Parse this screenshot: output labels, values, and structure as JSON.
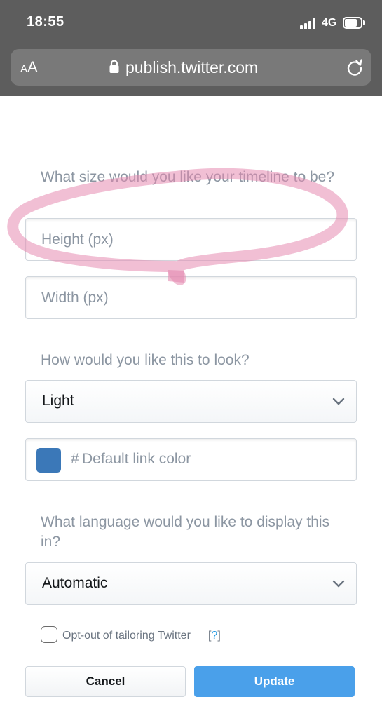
{
  "status_bar": {
    "time": "18:55",
    "network": "4G"
  },
  "browser": {
    "aa_large": "A",
    "aa_small": "A",
    "url": "publish.twitter.com"
  },
  "form": {
    "size_question": "What size would you like your timeline to be?",
    "height_placeholder": "Height (px)",
    "width_placeholder": "Width (px)",
    "look_question": "How would you like this to look?",
    "theme_selected": "Light",
    "link_color_hash": "#",
    "link_color_placeholder": "Default link color",
    "link_color_swatch": "#3b78b8",
    "language_question": "What language would you like to display this in?",
    "language_selected": "Automatic",
    "opt_out_label": "Opt-out of tailoring Twitter",
    "opt_out_help_open": "[",
    "opt_out_help_mark": "?",
    "opt_out_help_close": "]",
    "opt_out_checked": false
  },
  "buttons": {
    "cancel": "Cancel",
    "update": "Update"
  },
  "colors": {
    "accent": "#4aa0ea",
    "highlight_marker": "#e58ab0"
  }
}
